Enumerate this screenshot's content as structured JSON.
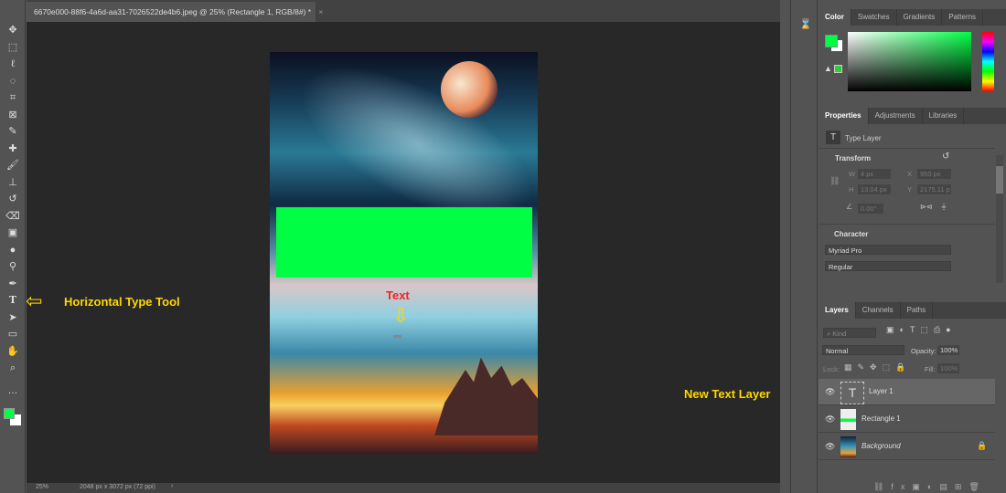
{
  "document": {
    "tab_title": "6670e000-88f6-4a6d-aa31-7026522de4b6.jpeg @ 25% (Rectangle 1, RGB/8#) *",
    "close": "×"
  },
  "status": {
    "zoom": "25%",
    "size": "2048 px x 3072 px (72 ppi)",
    "arrow": "›"
  },
  "toolbar": {
    "tools": [
      {
        "name": "move",
        "glyph": "✥"
      },
      {
        "name": "marquee",
        "glyph": "⬚"
      },
      {
        "name": "lasso",
        "glyph": "ℓ"
      },
      {
        "name": "quick-select",
        "glyph": "◌"
      },
      {
        "name": "crop",
        "glyph": "⌗"
      },
      {
        "name": "frame",
        "glyph": "⊠"
      },
      {
        "name": "eyedropper",
        "glyph": "✎"
      },
      {
        "name": "healing",
        "glyph": "✚"
      },
      {
        "name": "brush",
        "glyph": "🖌"
      },
      {
        "name": "stamp",
        "glyph": "⊥"
      },
      {
        "name": "history-brush",
        "glyph": "↺"
      },
      {
        "name": "eraser",
        "glyph": "⌫"
      },
      {
        "name": "gradient",
        "glyph": "▣"
      },
      {
        "name": "blur",
        "glyph": "●"
      },
      {
        "name": "dodge",
        "glyph": "⚲"
      },
      {
        "name": "pen",
        "glyph": "✒"
      },
      {
        "name": "type",
        "glyph": "T"
      },
      {
        "name": "path-select",
        "glyph": "➤"
      },
      {
        "name": "rectangle",
        "glyph": "▭"
      },
      {
        "name": "hand",
        "glyph": "✋"
      },
      {
        "name": "zoom",
        "glyph": "⌕"
      },
      {
        "name": "more",
        "glyph": "…"
      }
    ],
    "foreground": "#00ff44",
    "background": "#ffffff"
  },
  "annotations": {
    "type_tool": "Horizontal Type Tool",
    "text": "Text",
    "new_layer": "New Text Layer",
    "arrow_color": "#ffd700",
    "text_color": "#ff2020"
  },
  "color_panel": {
    "tabs": [
      "Color",
      "Swatches",
      "Gradients",
      "Patterns"
    ],
    "hue": "#00ff44"
  },
  "properties": {
    "tabs": [
      "Properties",
      "Adjustments",
      "Libraries"
    ],
    "type_label": "Type Layer",
    "transform_title": "Transform",
    "w_label": "W",
    "w": "4 px",
    "x_label": "X",
    "x": "950 px",
    "h_label": "H",
    "h": "13.04 px",
    "y_label": "Y",
    "y": "2175.11 p",
    "angle": "0.00°",
    "character_title": "Character",
    "font": "Myriad Pro",
    "style": "Regular"
  },
  "layers_panel": {
    "tabs": [
      "Layers",
      "Channels",
      "Paths"
    ],
    "kind": "Kind",
    "blend": "Normal",
    "opacity_label": "Opacity:",
    "opacity": "100%",
    "lock_label": "Lock:",
    "fill_label": "Fill:",
    "fill": "100%",
    "layers": [
      {
        "name": "Layer 1",
        "type": "text",
        "selected": true
      },
      {
        "name": "Rectangle 1",
        "type": "shape"
      },
      {
        "name": "Background",
        "type": "image",
        "locked": true
      }
    ]
  }
}
